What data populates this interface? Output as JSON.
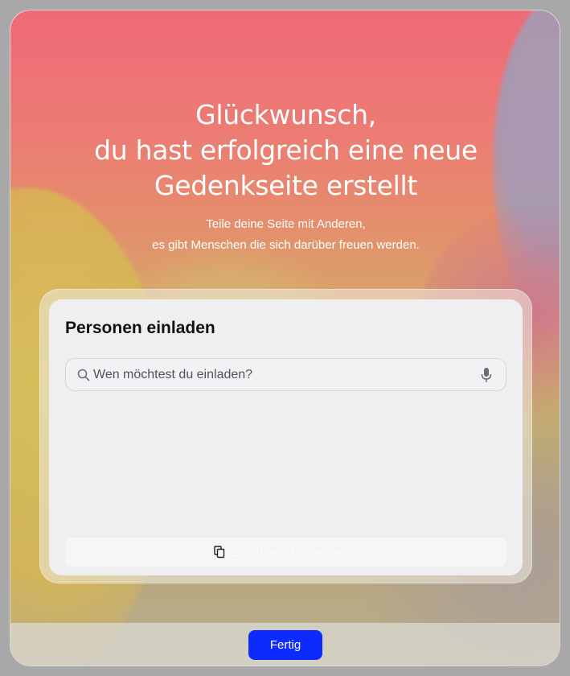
{
  "headline": "Glückwunsch,\ndu hast erfolgreich eine neue\nGedenkseite erstellt",
  "subline": "Teile deine Seite mit Anderen,\nes gibt Menschen die sich darüber freuen werden.",
  "invite": {
    "title": "Personen einladen",
    "search_placeholder": "Wen möchtest du einladen?",
    "search_value": "",
    "copy_link_label": "Einladungs-Link kopieren"
  },
  "footer": {
    "done_label": "Fertig"
  },
  "colors": {
    "primary_button": "#0d2bff",
    "card_background": "#efeff2",
    "headline_text": "#ffffff"
  },
  "icons": {
    "search": "search-icon",
    "microphone": "microphone-icon",
    "copy": "copy-icon"
  }
}
